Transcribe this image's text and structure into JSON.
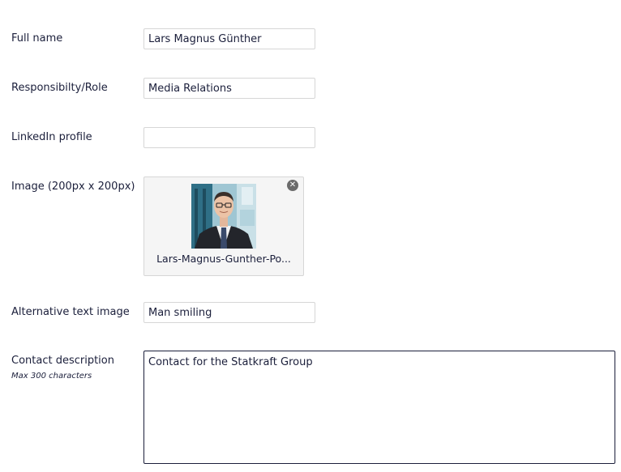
{
  "form": {
    "full_name": {
      "label": "Full name",
      "value": "Lars Magnus Günther"
    },
    "role": {
      "label": "Responsibilty/Role",
      "value": "Media Relations"
    },
    "linkedin": {
      "label": "LinkedIn profile",
      "value": ""
    },
    "image": {
      "label": "Image (200px x 200px)",
      "filename": "Lars-Magnus-Gunther-Po...",
      "remove_glyph": "✕"
    },
    "alt_text": {
      "label": "Alternative text image",
      "value": "Man smiling"
    },
    "description": {
      "label": "Contact description",
      "hint": "Max 300 characters",
      "value": "Contact for the Statkraft Group"
    }
  },
  "colors": {
    "text": "#1b1f3b",
    "input_border": "#d6d6d6",
    "image_box_bg": "#f5f5f5",
    "remove_icon": "#6b6b6b"
  }
}
